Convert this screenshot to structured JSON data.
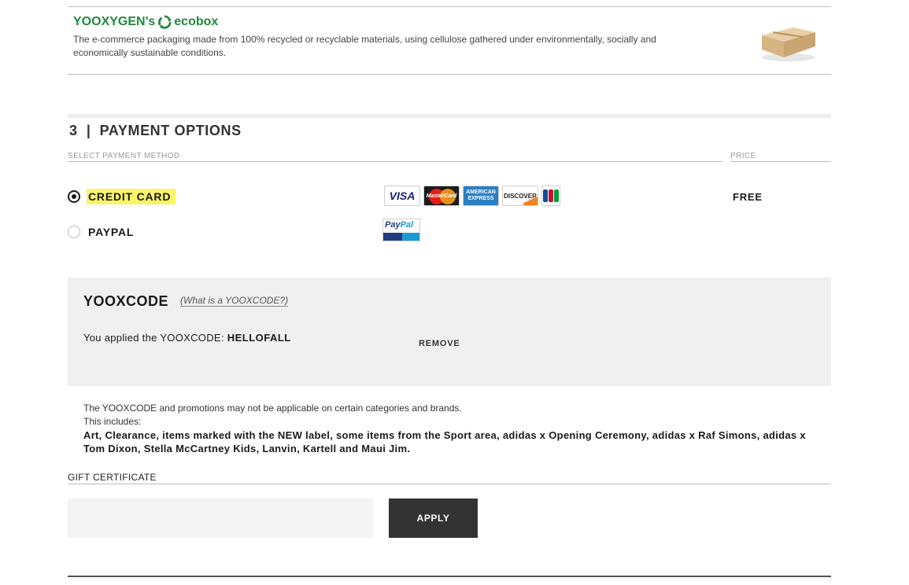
{
  "ecobox": {
    "title_prefix": "YOOXYGEN's",
    "title_suffix": "ecobox",
    "description": "The e-commerce packaging made from 100% recycled or recyclable materials, using cellulose gathered under environmentally, socially and economically sustainable conditions."
  },
  "payment": {
    "section_title": "3  |  PAYMENT OPTIONS",
    "column_method": "SELECT PAYMENT METHOD",
    "column_price": "PRICE",
    "methods": [
      {
        "label": "CREDIT CARD",
        "selected": true,
        "price": "FREE"
      },
      {
        "label": "PAYPAL",
        "selected": false,
        "price": ""
      }
    ],
    "card_logos": [
      "VISA",
      "MasterCard",
      "AMERICAN EXPRESS",
      "DISCOVER",
      "JCB"
    ],
    "paypal_logo": "PayPal"
  },
  "promo": {
    "title": "YOOXCODE",
    "help_link": "(What is a YOOXCODE?)",
    "applied_text": "You applied the YOOXCODE:",
    "applied_code": "HELLOFALL",
    "remove_label": "REMOVE"
  },
  "disclaimer": {
    "line1": "The YOOXCODE and promotions may not be applicable on certain categories and brands.",
    "line2": "This includes:",
    "exclusions": "Art, Clearance, items marked with the NEW label, some items from the Sport area, adidas x Opening Ceremony, adidas x Raf Simons, adidas x Tom Dixon, Stella McCartney Kids, Lanvin, Kartell and Maui Jim."
  },
  "gift": {
    "label": "GIFT CERTIFICATE",
    "input_value": "",
    "apply_label": "APPLY"
  },
  "colors": {
    "eco_green": "#1f8a3b",
    "highlight": "#fbf56a",
    "button_dark": "#333333"
  }
}
